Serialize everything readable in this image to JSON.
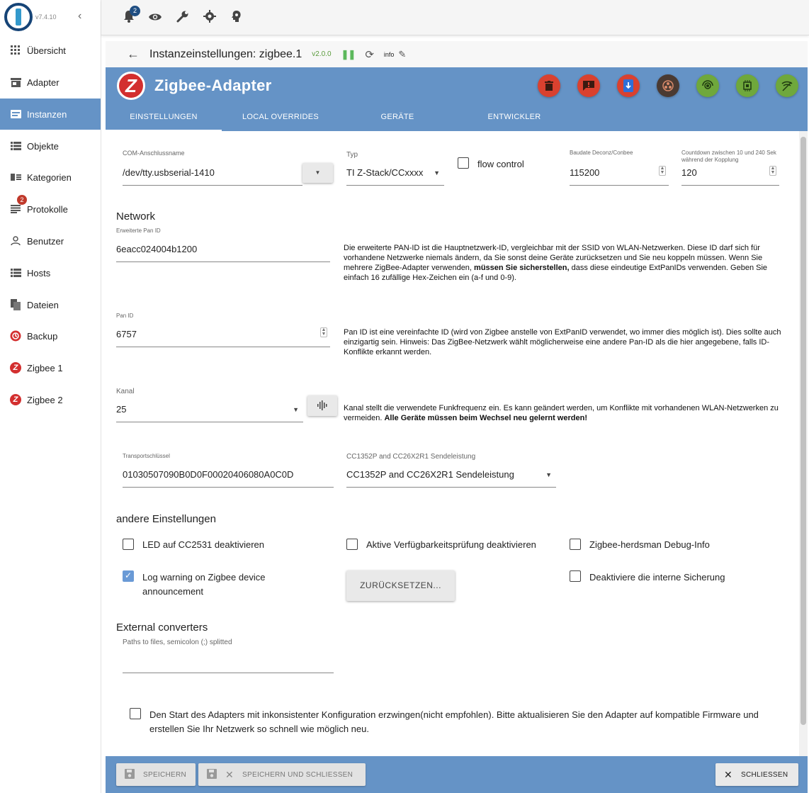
{
  "app": {
    "version": "v7.4.10"
  },
  "topbar": {
    "notifications_count": "2"
  },
  "sidebar": {
    "items": [
      {
        "label": "Übersicht",
        "icon": "grid-icon"
      },
      {
        "label": "Adapter",
        "icon": "store-icon"
      },
      {
        "label": "Instanzen",
        "icon": "instances-icon",
        "active": true
      },
      {
        "label": "Objekte",
        "icon": "list-icon"
      },
      {
        "label": "Kategorien",
        "icon": "categories-icon"
      },
      {
        "label": "Protokolle",
        "icon": "log-icon",
        "badge": "2"
      },
      {
        "label": "Benutzer",
        "icon": "user-icon"
      },
      {
        "label": "Hosts",
        "icon": "hosts-icon"
      },
      {
        "label": "Dateien",
        "icon": "files-icon"
      },
      {
        "label": "Backup",
        "icon": "backup-icon"
      },
      {
        "label": "Zigbee 1",
        "icon": "zigbee-icon"
      },
      {
        "label": "Zigbee 2",
        "icon": "zigbee-icon"
      }
    ]
  },
  "header": {
    "title": "Instanzeinstellungen: zigbee.1",
    "version": "v2.0.0",
    "info": "info"
  },
  "adapter": {
    "title": "Zigbee-Adapter",
    "logo_letter": "Z",
    "tabs": [
      "EINSTELLUNGEN",
      "LOCAL OVERRIDES",
      "GERÄTE",
      "ENTWICKLER"
    ],
    "colors": {
      "header": "#6593c6",
      "red": "#d9412f",
      "dark": "#4a3a32",
      "green": "#6fa83c",
      "blue": "#2f6fd8"
    }
  },
  "form": {
    "com_port": {
      "label": "COM-Anschlussname",
      "value": "/dev/tty.usbserial-1410"
    },
    "typ": {
      "label": "Typ",
      "value": "TI Z-Stack/CCxxxx"
    },
    "flow_control": {
      "label": "flow control"
    },
    "baudrate": {
      "label": "Baudate Deconz/Conbee",
      "value": "115200"
    },
    "countdown": {
      "label": "Countdown zwischen 10 und 240 Sek während der Kopplung",
      "value": "120"
    },
    "network_title": "Network",
    "ext_pan": {
      "label": "Erweiterte Pan ID",
      "value": "6eacc024004b1200"
    },
    "ext_pan_desc_1": "Die erweiterte PAN-ID ist die Hauptnetzwerk-ID, vergleichbar mit der SSID von WLAN-Netzwerken. Diese ID darf sich für vorhandene Netzwerke niemals ändern, da Sie sonst deine Geräte zurücksetzen und Sie neu koppeln müssen. Wenn Sie mehrere ZigBee-Adapter verwenden,",
    "ext_pan_desc_bold": "müssen Sie sicherstellen,",
    "ext_pan_desc_2": "dass diese eindeutige ExtPanIDs verwenden. Geben Sie einfach 16 zufällige Hex-Zeichen ein (a-f und 0-9).",
    "pan": {
      "label": "Pan ID",
      "value": "6757"
    },
    "pan_desc": "Pan ID ist eine vereinfachte ID (wird von Zigbee anstelle von ExtPanID verwendet, wo immer dies möglich ist). Dies sollte auch einzigartig sein. Hinweis: Das ZigBee-Netzwerk wählt möglicherweise eine andere Pan-ID als die hier angegebene, falls ID-Konflikte erkannt werden.",
    "kanal": {
      "label": "Kanal",
      "value": "25"
    },
    "kanal_desc_1": "Kanal stellt die verwendete Funkfrequenz ein. Es kann geändert werden, um Konflikte mit vorhandenen WLAN-Netzwerken zu vermeiden.",
    "kanal_desc_bold": "Alle Geräte müssen beim Wechsel neu gelernt werden!",
    "transport": {
      "label": "Transportschlüssel",
      "value": "01030507090B0D0F00020406080A0C0D"
    },
    "power": {
      "label": "CC1352P and CC26X2R1 Sendeleistung",
      "value": "CC1352P and CC26X2R1 Sendeleistung"
    },
    "other_title": "andere Einstellungen",
    "cb_led": "LED auf CC2531 deaktivieren",
    "cb_availability": "Aktive Verfügbarkeitsprüfung deaktivieren",
    "cb_debug": "Zigbee-herdsman Debug-Info",
    "cb_log_warning": "Log warning on Zigbee device announcement",
    "reset_button": "ZURÜCKSETZEN...",
    "cb_backup": "Deaktiviere die interne Sicherung",
    "ext_conv_title": "External converters",
    "ext_conv": {
      "label": "Paths to files, semicolon (;) splitted",
      "value": ""
    },
    "cb_force": "Den Start des Adapters mit inkonsistenter Konfiguration erzwingen(nicht empfohlen). Bitte aktualisieren Sie den Adapter auf kompatible Firmware und erstellen Sie Ihr Netzwerk so schnell wie möglich neu."
  },
  "footer": {
    "save": "SPEICHERN",
    "save_close": "SPEICHERN UND SCHLIESSEN",
    "close": "SCHLIESSEN"
  }
}
